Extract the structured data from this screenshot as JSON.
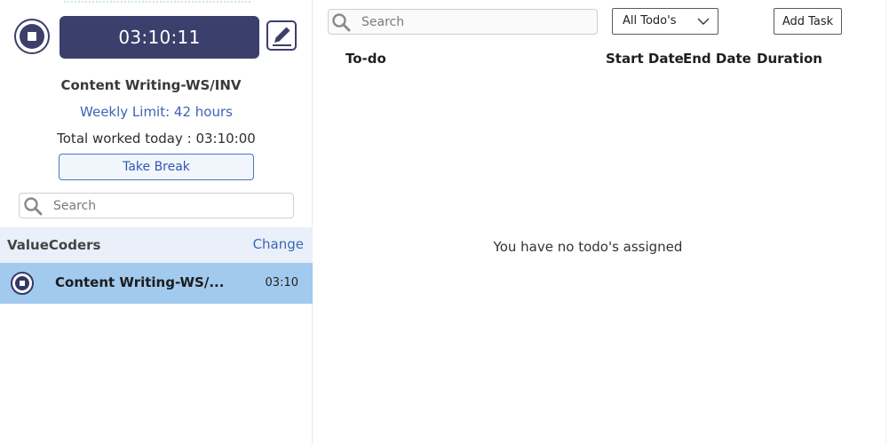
{
  "timer": {
    "elapsed": "03:10:11"
  },
  "project": {
    "name": "Content Writing-WS/INV",
    "weekly_limit": "Weekly Limit: 42 hours",
    "total_worked": "Total worked today : 03:10:00"
  },
  "actions": {
    "take_break": "Take Break"
  },
  "sidebar": {
    "search_placeholder": "Search",
    "organization": {
      "name": "ValueCoders",
      "change_label": "Change"
    },
    "projects": [
      {
        "title": "Content Writing-WS/...",
        "time": "03:10",
        "active": true
      }
    ]
  },
  "main": {
    "search_placeholder": "Search",
    "filter": {
      "selected": "All Todo's"
    },
    "add_task_label": "Add Task",
    "columns": {
      "todo": "To-do",
      "start_date": "Start Date",
      "end_date": "End Date",
      "duration": "Duration"
    },
    "empty_message": "You have no todo's assigned"
  },
  "colors": {
    "primary": "#3b3f6b",
    "link": "#3f66b8",
    "active_row": "#a2caee",
    "org_row": "#e9f0fa"
  },
  "icons": [
    "stop-icon",
    "edit-icon",
    "search-icon",
    "chevron-down-icon"
  ]
}
